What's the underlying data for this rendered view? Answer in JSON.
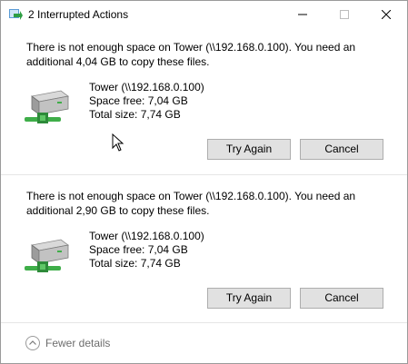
{
  "window": {
    "title": "2 Interrupted Actions"
  },
  "actions": [
    {
      "message": "There is not enough space on Tower (\\\\192.168.0.100). You need an additional 4,04 GB to copy these files.",
      "drive_name": "Tower (\\\\192.168.0.100)",
      "space_free": "Space free: 7,04 GB",
      "total_size": "Total size: 7,74 GB",
      "try_again_label": "Try Again",
      "cancel_label": "Cancel"
    },
    {
      "message": "There is not enough space on Tower (\\\\192.168.0.100). You need an additional 2,90 GB to copy these files.",
      "drive_name": "Tower (\\\\192.168.0.100)",
      "space_free": "Space free: 7,04 GB",
      "total_size": "Total size: 7,74 GB",
      "try_again_label": "Try Again",
      "cancel_label": "Cancel"
    }
  ],
  "footer": {
    "toggle_label": "Fewer details",
    "toggle_icon": "chevron-up-circle-icon"
  },
  "icons": {
    "app": "copy-arrow-icon",
    "drive": "network-drive-icon",
    "minimize": "minimize-icon",
    "maximize": "maximize-icon",
    "close": "close-icon",
    "cursor": "mouse-pointer-icon"
  },
  "colors": {
    "button_bg": "#e1e1e1",
    "button_border": "#adadad",
    "drive_green": "#3fae49",
    "divider": "#e6e6e6"
  }
}
